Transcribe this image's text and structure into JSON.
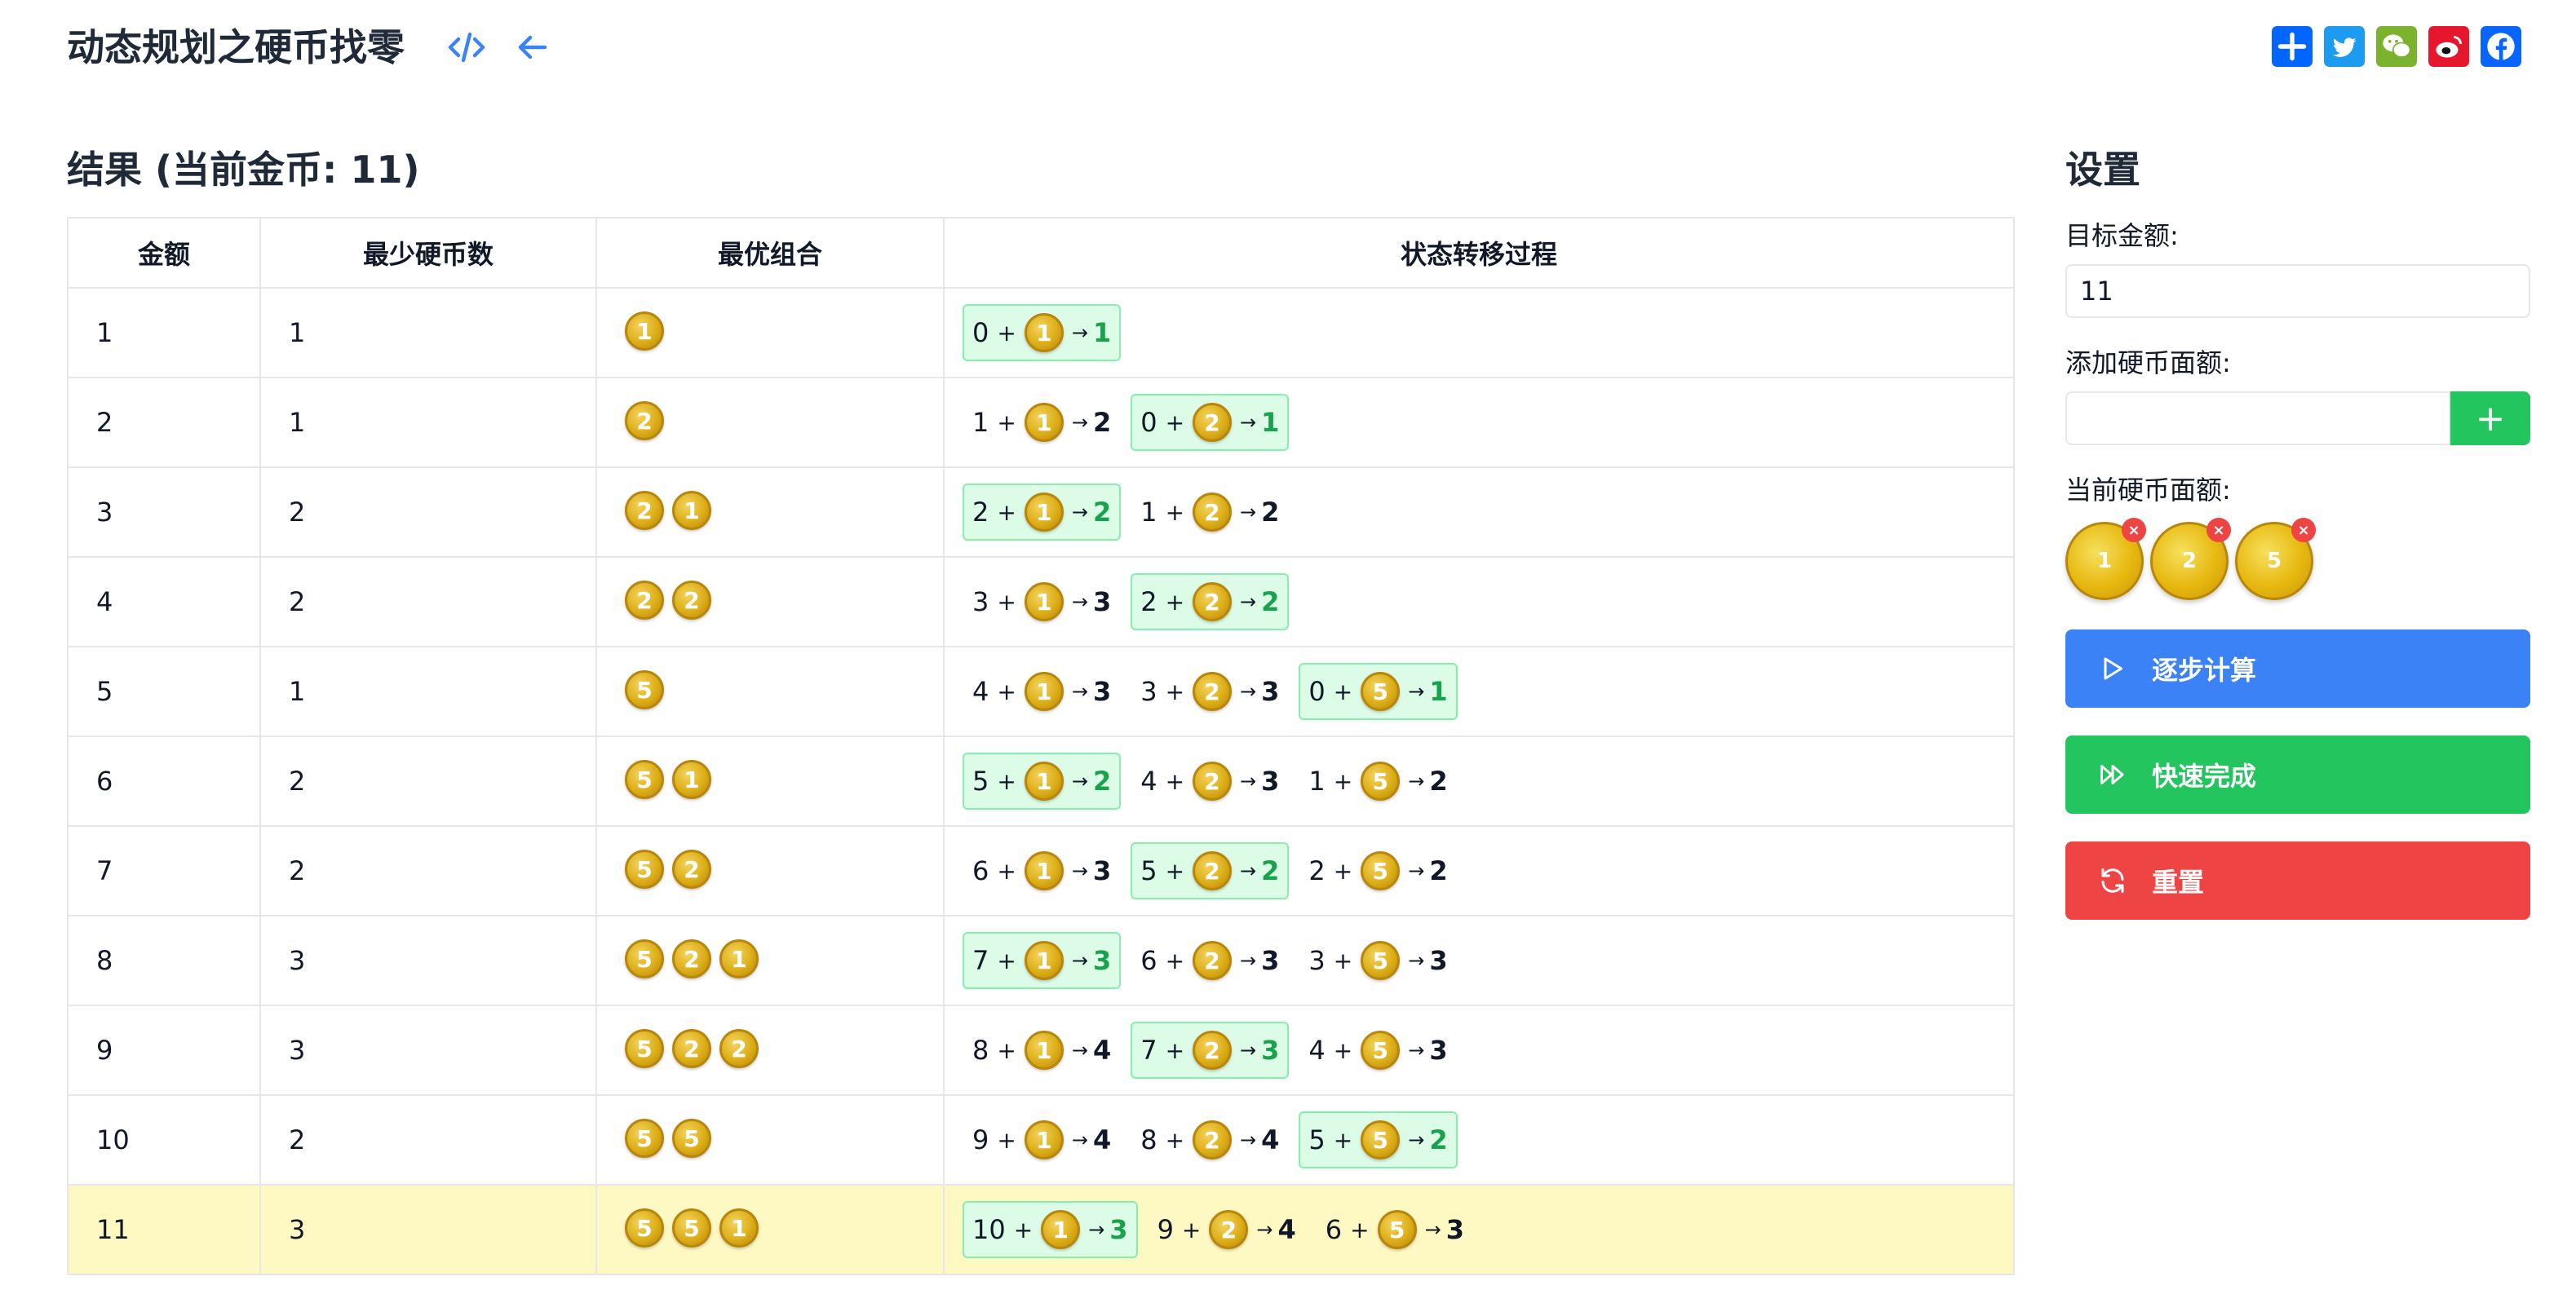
{
  "header": {
    "title": "动态规划之硬币找零"
  },
  "result": {
    "title": "结果 (当前金币: 11)",
    "columns": [
      "金额",
      "最少硬币数",
      "最优组合",
      "状态转移过程"
    ],
    "rows": [
      {
        "amount": "1",
        "min": "1",
        "combo": [
          "1"
        ],
        "steps": [
          {
            "from": "0",
            "coin": "1",
            "res": "1",
            "best": true
          }
        ]
      },
      {
        "amount": "2",
        "min": "1",
        "combo": [
          "2"
        ],
        "steps": [
          {
            "from": "1",
            "coin": "1",
            "res": "2",
            "best": false
          },
          {
            "from": "0",
            "coin": "2",
            "res": "1",
            "best": true
          }
        ]
      },
      {
        "amount": "3",
        "min": "2",
        "combo": [
          "2",
          "1"
        ],
        "steps": [
          {
            "from": "2",
            "coin": "1",
            "res": "2",
            "best": true
          },
          {
            "from": "1",
            "coin": "2",
            "res": "2",
            "best": false
          }
        ]
      },
      {
        "amount": "4",
        "min": "2",
        "combo": [
          "2",
          "2"
        ],
        "steps": [
          {
            "from": "3",
            "coin": "1",
            "res": "3",
            "best": false
          },
          {
            "from": "2",
            "coin": "2",
            "res": "2",
            "best": true
          }
        ]
      },
      {
        "amount": "5",
        "min": "1",
        "combo": [
          "5"
        ],
        "steps": [
          {
            "from": "4",
            "coin": "1",
            "res": "3",
            "best": false
          },
          {
            "from": "3",
            "coin": "2",
            "res": "3",
            "best": false
          },
          {
            "from": "0",
            "coin": "5",
            "res": "1",
            "best": true
          }
        ]
      },
      {
        "amount": "6",
        "min": "2",
        "combo": [
          "5",
          "1"
        ],
        "steps": [
          {
            "from": "5",
            "coin": "1",
            "res": "2",
            "best": true
          },
          {
            "from": "4",
            "coin": "2",
            "res": "3",
            "best": false
          },
          {
            "from": "1",
            "coin": "5",
            "res": "2",
            "best": false
          }
        ]
      },
      {
        "amount": "7",
        "min": "2",
        "combo": [
          "5",
          "2"
        ],
        "steps": [
          {
            "from": "6",
            "coin": "1",
            "res": "3",
            "best": false
          },
          {
            "from": "5",
            "coin": "2",
            "res": "2",
            "best": true
          },
          {
            "from": "2",
            "coin": "5",
            "res": "2",
            "best": false
          }
        ]
      },
      {
        "amount": "8",
        "min": "3",
        "combo": [
          "5",
          "2",
          "1"
        ],
        "steps": [
          {
            "from": "7",
            "coin": "1",
            "res": "3",
            "best": true
          },
          {
            "from": "6",
            "coin": "2",
            "res": "3",
            "best": false
          },
          {
            "from": "3",
            "coin": "5",
            "res": "3",
            "best": false
          }
        ]
      },
      {
        "amount": "9",
        "min": "3",
        "combo": [
          "5",
          "2",
          "2"
        ],
        "steps": [
          {
            "from": "8",
            "coin": "1",
            "res": "4",
            "best": false
          },
          {
            "from": "7",
            "coin": "2",
            "res": "3",
            "best": true
          },
          {
            "from": "4",
            "coin": "5",
            "res": "3",
            "best": false
          }
        ]
      },
      {
        "amount": "10",
        "min": "2",
        "combo": [
          "5",
          "5"
        ],
        "steps": [
          {
            "from": "9",
            "coin": "1",
            "res": "4",
            "best": false
          },
          {
            "from": "8",
            "coin": "2",
            "res": "4",
            "best": false
          },
          {
            "from": "5",
            "coin": "5",
            "res": "2",
            "best": true
          }
        ]
      },
      {
        "amount": "11",
        "min": "3",
        "combo": [
          "5",
          "5",
          "1"
        ],
        "highlight": true,
        "steps": [
          {
            "from": "10",
            "coin": "1",
            "res": "3",
            "best": true
          },
          {
            "from": "9",
            "coin": "2",
            "res": "4",
            "best": false
          },
          {
            "from": "6",
            "coin": "5",
            "res": "3",
            "best": false
          }
        ]
      }
    ]
  },
  "settings": {
    "title": "设置",
    "target_label": "目标金额:",
    "target_value": "11",
    "add_label": "添加硬币面额:",
    "add_value": "",
    "add_button": "+",
    "current_label": "当前硬币面额:",
    "coins": [
      "1",
      "2",
      "5"
    ],
    "remove_symbol": "×",
    "step_button": "逐步计算",
    "fast_button": "快速完成",
    "reset_button": "重置"
  },
  "symbols": {
    "plus": "+",
    "arrow": "→"
  },
  "icons": [
    "code-icon",
    "back-arrow-icon",
    "share-plus-icon",
    "twitter-icon",
    "wechat-icon",
    "weibo-icon",
    "facebook-icon",
    "play-icon",
    "fast-forward-icon",
    "refresh-icon"
  ],
  "colors": {
    "accent_blue": "#3b82f6",
    "success_green": "#22c55e",
    "danger_red": "#ef4444",
    "highlight_row": "#fef9c3",
    "best_step_bg": "#dcfce7",
    "best_step_text": "#16a34a",
    "coin_gold": "#dcae17"
  }
}
